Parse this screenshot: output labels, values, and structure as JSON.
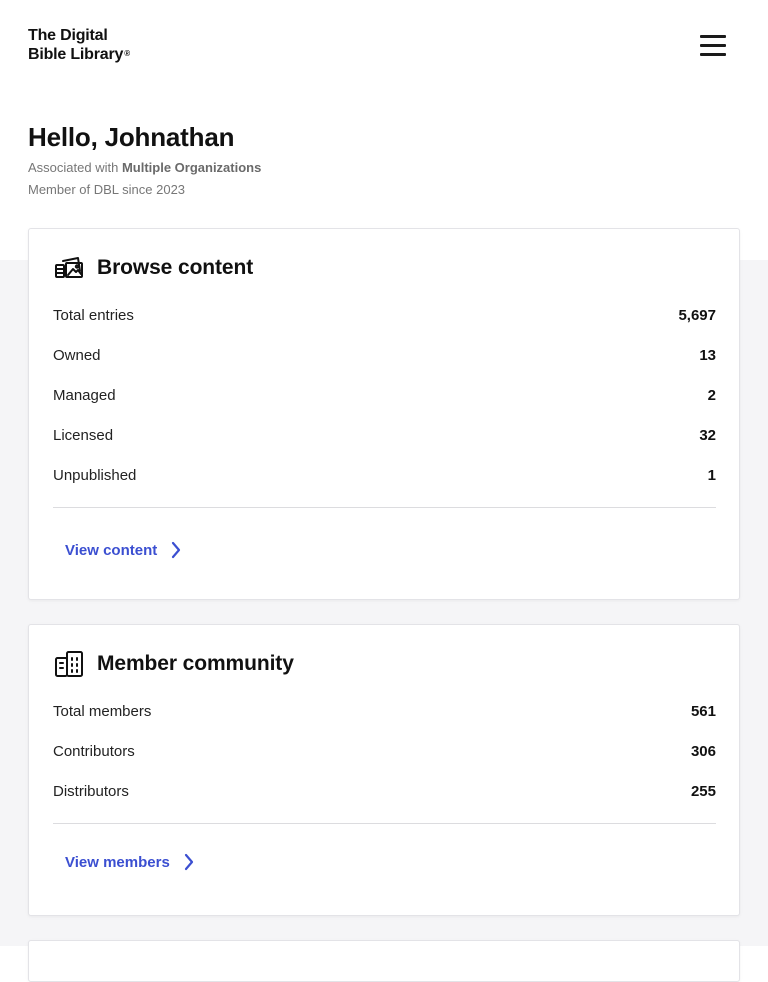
{
  "header": {
    "logo_line1": "The Digital",
    "logo_line2": "Bible Library",
    "logo_mark": "®"
  },
  "greeting": {
    "hello": "Hello, Johnathan",
    "associated_prefix": "Associated with ",
    "associated_orgs": "Multiple Organizations",
    "member_since": "Member of DBL since 2023"
  },
  "browse": {
    "title": "Browse content",
    "icon": "media-library-icon",
    "rows": [
      {
        "label": "Total entries",
        "value": "5,697"
      },
      {
        "label": "Owned",
        "value": "13"
      },
      {
        "label": "Managed",
        "value": "2"
      },
      {
        "label": "Licensed",
        "value": "32"
      },
      {
        "label": "Unpublished",
        "value": "1"
      }
    ],
    "link": "View content"
  },
  "members": {
    "title": "Member community",
    "icon": "buildings-icon",
    "rows": [
      {
        "label": "Total members",
        "value": "561"
      },
      {
        "label": "Contributors",
        "value": "306"
      },
      {
        "label": "Distributors",
        "value": "255"
      }
    ],
    "link": "View members"
  },
  "colors": {
    "accent": "#3b4fd1",
    "page_bg": "#f5f5f7"
  }
}
